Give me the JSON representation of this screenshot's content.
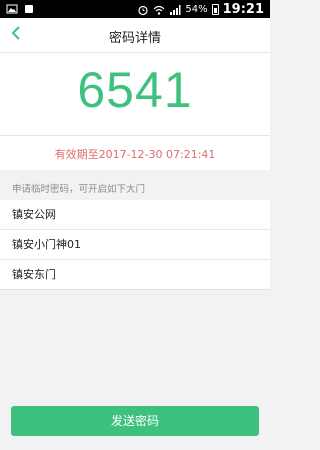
{
  "status_bar": {
    "battery_percent": "54%",
    "time": "19:21"
  },
  "header": {
    "title": "密码详情",
    "back_icon": "chevron-left-icon"
  },
  "password": {
    "code": "6541",
    "validity": "有效期至2017-12-30 07:21:41"
  },
  "doors": {
    "hint": "申请临时密码，可开启如下大门",
    "items": [
      {
        "label": "镇安公网"
      },
      {
        "label": "镇安小门神01"
      },
      {
        "label": "镇安东门"
      }
    ]
  },
  "actions": {
    "send_label": "发送密码"
  },
  "colors": {
    "accent": "#3ec17e",
    "warning": "#e06b6b"
  }
}
